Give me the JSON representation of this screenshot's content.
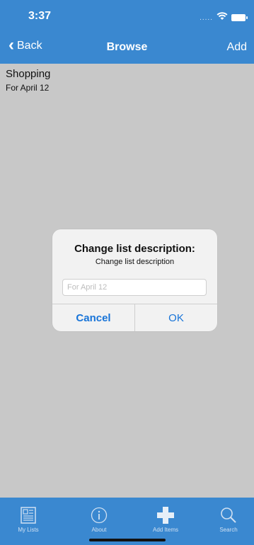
{
  "status_bar": {
    "time": "3:37",
    "signal": "....."
  },
  "nav": {
    "back_label": "Back",
    "title": "Browse",
    "add_label": "Add"
  },
  "list": [
    {
      "title": "Shopping",
      "description": "For April 12"
    }
  ],
  "alert": {
    "title": "Change list description:",
    "message": "Change list description",
    "input_placeholder": "For April 12",
    "cancel_label": "Cancel",
    "ok_label": "OK"
  },
  "tabs": [
    {
      "label": "My Lists",
      "icon": "list-icon"
    },
    {
      "label": "About",
      "icon": "info-icon"
    },
    {
      "label": "Add Items",
      "icon": "plus-icon"
    },
    {
      "label": "Search",
      "icon": "search-icon"
    }
  ],
  "colors": {
    "bar": "#3a88d0",
    "background": "#c8c8c8",
    "alert_button": "#1874d8"
  }
}
